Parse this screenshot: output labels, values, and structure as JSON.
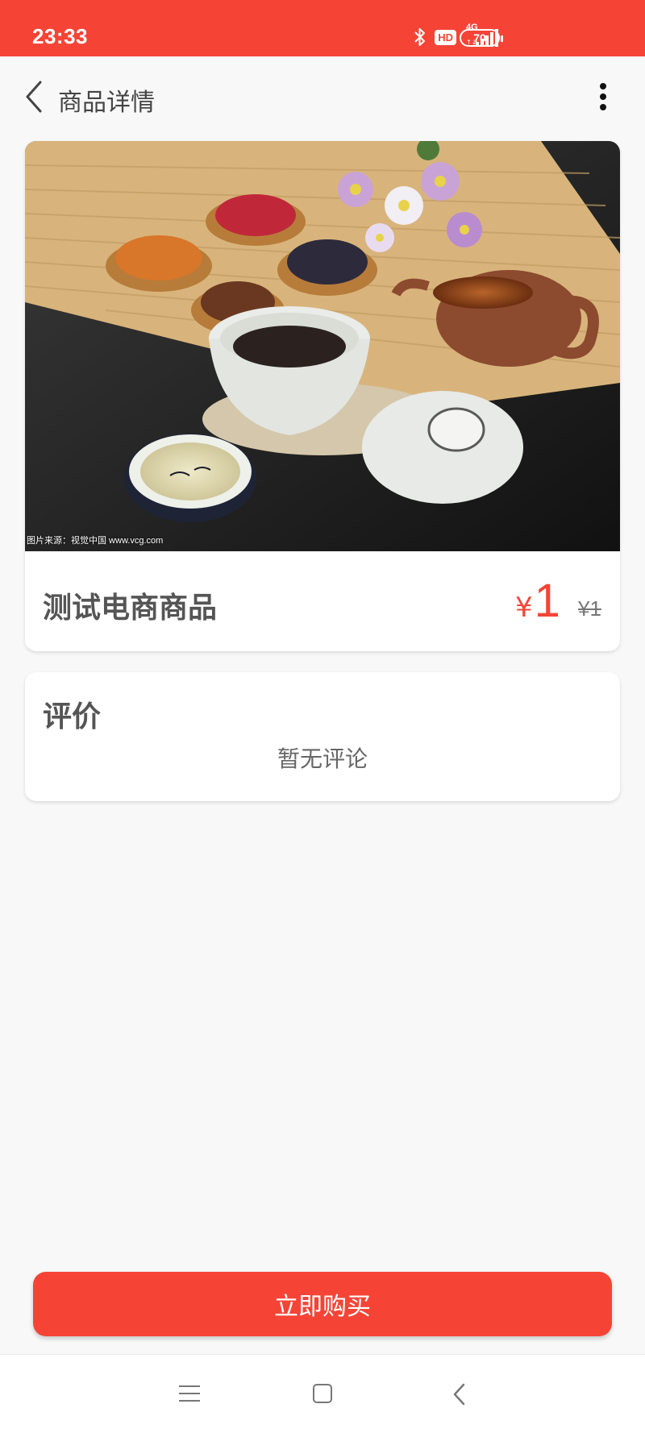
{
  "status_bar": {
    "time": "23:33",
    "icons": [
      "bluetooth-icon",
      "hd-icon",
      "signal-4g-icon",
      "battery-icon"
    ],
    "hd_label": "HD",
    "network_label": "4G",
    "battery_level": "70"
  },
  "header": {
    "title": "商品详情",
    "back_icon": "chevron-left-icon",
    "more_icon": "more-vertical-icon"
  },
  "product": {
    "image_credit": "图片来源：视觉中国 www.vcg.com",
    "name": "测试电商商品",
    "price_symbol": "¥",
    "price": "1",
    "original_price": "¥1"
  },
  "reviews": {
    "title": "评价",
    "empty_text": "暂无评论"
  },
  "actions": {
    "buy_label": "立即购买"
  },
  "nav_bar": {
    "icons": [
      "menu-icon",
      "home-icon",
      "back-icon"
    ]
  },
  "colors": {
    "accent": "#f54436",
    "background": "#f8f8f8",
    "card": "#ffffff"
  }
}
